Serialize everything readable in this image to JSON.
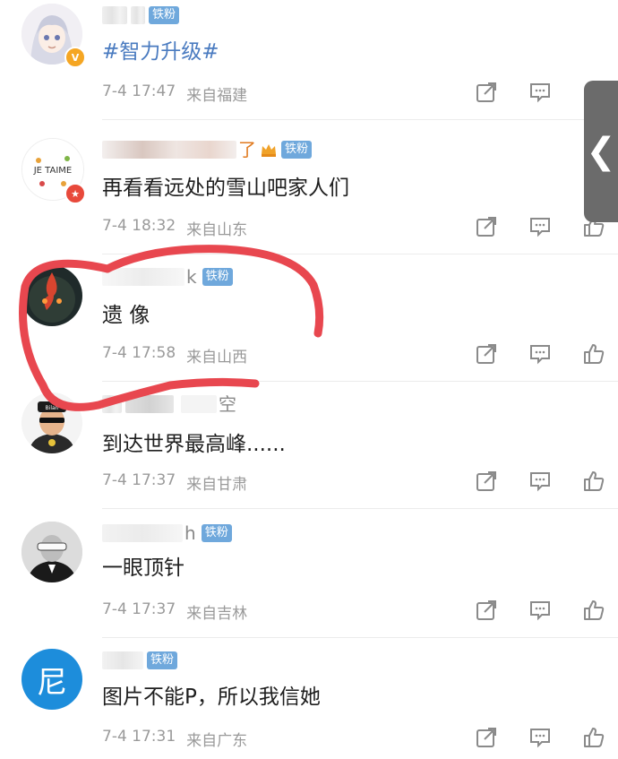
{
  "comments": [
    {
      "name_visible": "",
      "badge": "铁粉",
      "text": "#智力升级#",
      "date": "7-4 17:47",
      "location": "来自福建"
    },
    {
      "name_visible": "了",
      "badge": "铁粉",
      "text": "再看看远处的雪山吧家人们",
      "date": "7-4 18:32",
      "location": "来自山东"
    },
    {
      "name_visible": "k",
      "badge": "铁粉",
      "text": "遗 像",
      "date": "7-4 17:58",
      "location": "来自山西"
    },
    {
      "name_visible": "空",
      "badge": "",
      "text": "到达世界最高峰......",
      "date": "7-4 17:37",
      "location": "来自甘肃"
    },
    {
      "name_visible": "h",
      "badge": "铁粉",
      "text": "一眼顶针",
      "date": "7-4 17:37",
      "location": "来自吉林"
    },
    {
      "name_visible": "",
      "badge": "铁粉",
      "text": "图片不能P，所以我信她",
      "date": "7-4 17:31",
      "location": "来自广东",
      "avatar_char": "尼"
    }
  ],
  "avatar2_text": "JE TAIME",
  "avatar4_text": "Bilan",
  "side_tab_glyph": "❮",
  "icons": [
    "share-icon",
    "comment-icon",
    "like-icon"
  ],
  "colors": {
    "badge_blue": "#6fa8dc",
    "hashtag": "#4a7bc0",
    "annotation_red": "#e8474f",
    "avatar_blue": "#1d8ddb"
  }
}
